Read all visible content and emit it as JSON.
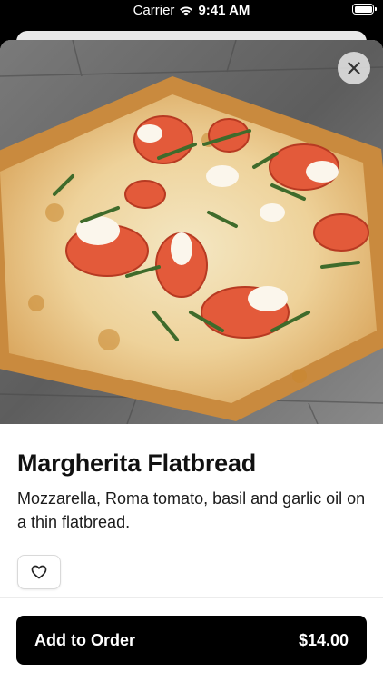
{
  "status_bar": {
    "carrier": "Carrier",
    "time": "9:41 AM"
  },
  "item": {
    "name": "Margherita Flatbread",
    "description": "Mozzarella, Roma tomato, basil and garlic oil on a thin flatbread.",
    "image_subject": "margherita-flatbread-photo"
  },
  "actions": {
    "close_icon": "close-icon",
    "favorite_icon": "heart-icon",
    "add_label": "Add to Order",
    "price": "$14.00"
  },
  "colors": {
    "primary_button": "#000000",
    "text": "#111111",
    "background": "#ffffff"
  }
}
